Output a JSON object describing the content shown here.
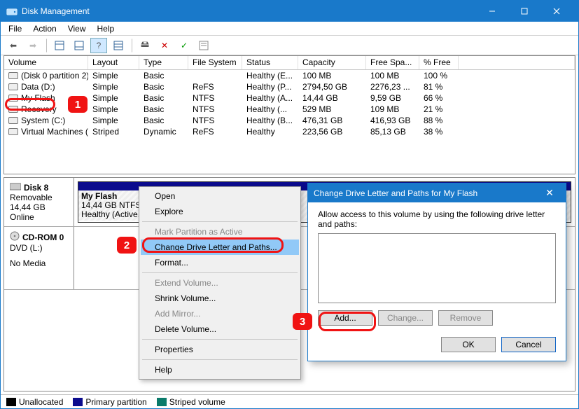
{
  "window": {
    "title": "Disk Management"
  },
  "menu": {
    "file": "File",
    "action": "Action",
    "view": "View",
    "help": "Help"
  },
  "columns": [
    "Volume",
    "Layout",
    "Type",
    "File System",
    "Status",
    "Capacity",
    "Free Spa...",
    "% Free"
  ],
  "volumes": [
    {
      "name": "(Disk 0 partition 2)",
      "layout": "Simple",
      "type": "Basic",
      "fs": "",
      "status": "Healthy (E...",
      "cap": "100 MB",
      "free": "100 MB",
      "pct": "100 %"
    },
    {
      "name": "Data (D:)",
      "layout": "Simple",
      "type": "Basic",
      "fs": "ReFS",
      "status": "Healthy (P...",
      "cap": "2794,50 GB",
      "free": "2276,23 ...",
      "pct": "81 %"
    },
    {
      "name": "My Flash",
      "layout": "Simple",
      "type": "Basic",
      "fs": "NTFS",
      "status": "Healthy (A...",
      "cap": "14,44 GB",
      "free": "9,59 GB",
      "pct": "66 %"
    },
    {
      "name": "Recovery",
      "layout": "Simple",
      "type": "Basic",
      "fs": "NTFS",
      "status": "Healthy (...",
      "cap": "529 MB",
      "free": "109 MB",
      "pct": "21 %"
    },
    {
      "name": "System (C:)",
      "layout": "Simple",
      "type": "Basic",
      "fs": "NTFS",
      "status": "Healthy (B...",
      "cap": "476,31 GB",
      "free": "416,93 GB",
      "pct": "88 %"
    },
    {
      "name": "Virtual Machines (...",
      "layout": "Striped",
      "type": "Dynamic",
      "fs": "ReFS",
      "status": "Healthy",
      "cap": "223,56 GB",
      "free": "85,13 GB",
      "pct": "38 %"
    }
  ],
  "disk8": {
    "title": "Disk 8",
    "kind": "Removable",
    "size": "14,44 GB",
    "state": "Online",
    "partName": "My Flash",
    "partLine2": "14,44 GB NTFS",
    "partLine3": "Healthy (Active, Primary Partition)"
  },
  "cdrom": {
    "title": "CD-ROM 0",
    "line2": "DVD (L:)",
    "line3": "No Media"
  },
  "legend": {
    "un": "Unallocated",
    "pp": "Primary partition",
    "sv": "Striped volume"
  },
  "ctx": {
    "open": "Open",
    "explore": "Explore",
    "mark": "Mark Partition as Active",
    "change": "Change Drive Letter and Paths...",
    "format": "Format...",
    "extend": "Extend Volume...",
    "shrink": "Shrink Volume...",
    "mirror": "Add Mirror...",
    "delete": "Delete Volume...",
    "props": "Properties",
    "help": "Help"
  },
  "dlg": {
    "title": "Change Drive Letter and Paths for My Flash",
    "msg": "Allow access to this volume by using the following drive letter and paths:",
    "add": "Add...",
    "changeBtn": "Change...",
    "remove": "Remove",
    "ok": "OK",
    "cancel": "Cancel"
  },
  "marks": {
    "one": "1",
    "two": "2",
    "three": "3"
  }
}
